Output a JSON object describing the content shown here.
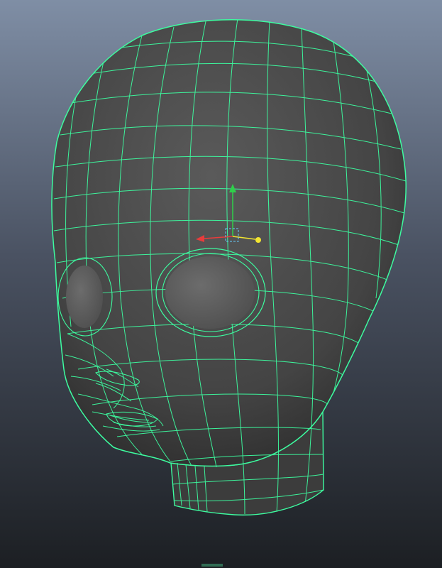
{
  "viewport": {
    "background_top": "#7f8ea5",
    "background_bottom": "#1c1f23"
  },
  "model": {
    "name": "head-mesh",
    "surface_color": "#4a4a4a",
    "eye_color": "#5c5c5c",
    "wireframe_color": "#3dfca0"
  },
  "manipulator": {
    "x_axis_color": "#e83c3c",
    "y_axis_color": "#2fd04a",
    "z_axis_color": "#f2e531",
    "pivot_color": "#66ccff"
  }
}
